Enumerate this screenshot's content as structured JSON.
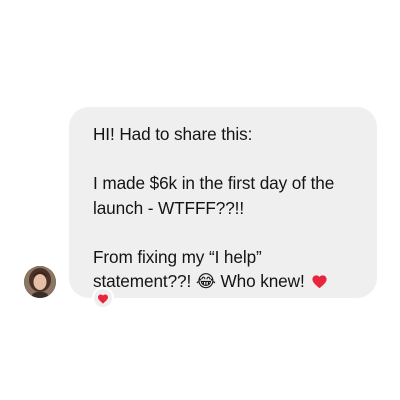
{
  "message": {
    "greeting": "HI! Had to share this:",
    "body": "I made $6k in the first day of the launch - WTFFF??!!",
    "closing_text": "From fixing my “I help” statement??! ",
    "closing_emoji": "😂",
    "closing_tail": " Who knew! ",
    "inline_icon": "red-heart-icon"
  },
  "reaction": {
    "icon": "heart-icon",
    "emoji": "❤️"
  },
  "colors": {
    "bubble": "#efefef",
    "text": "#141414",
    "heart": "#e8253d"
  }
}
